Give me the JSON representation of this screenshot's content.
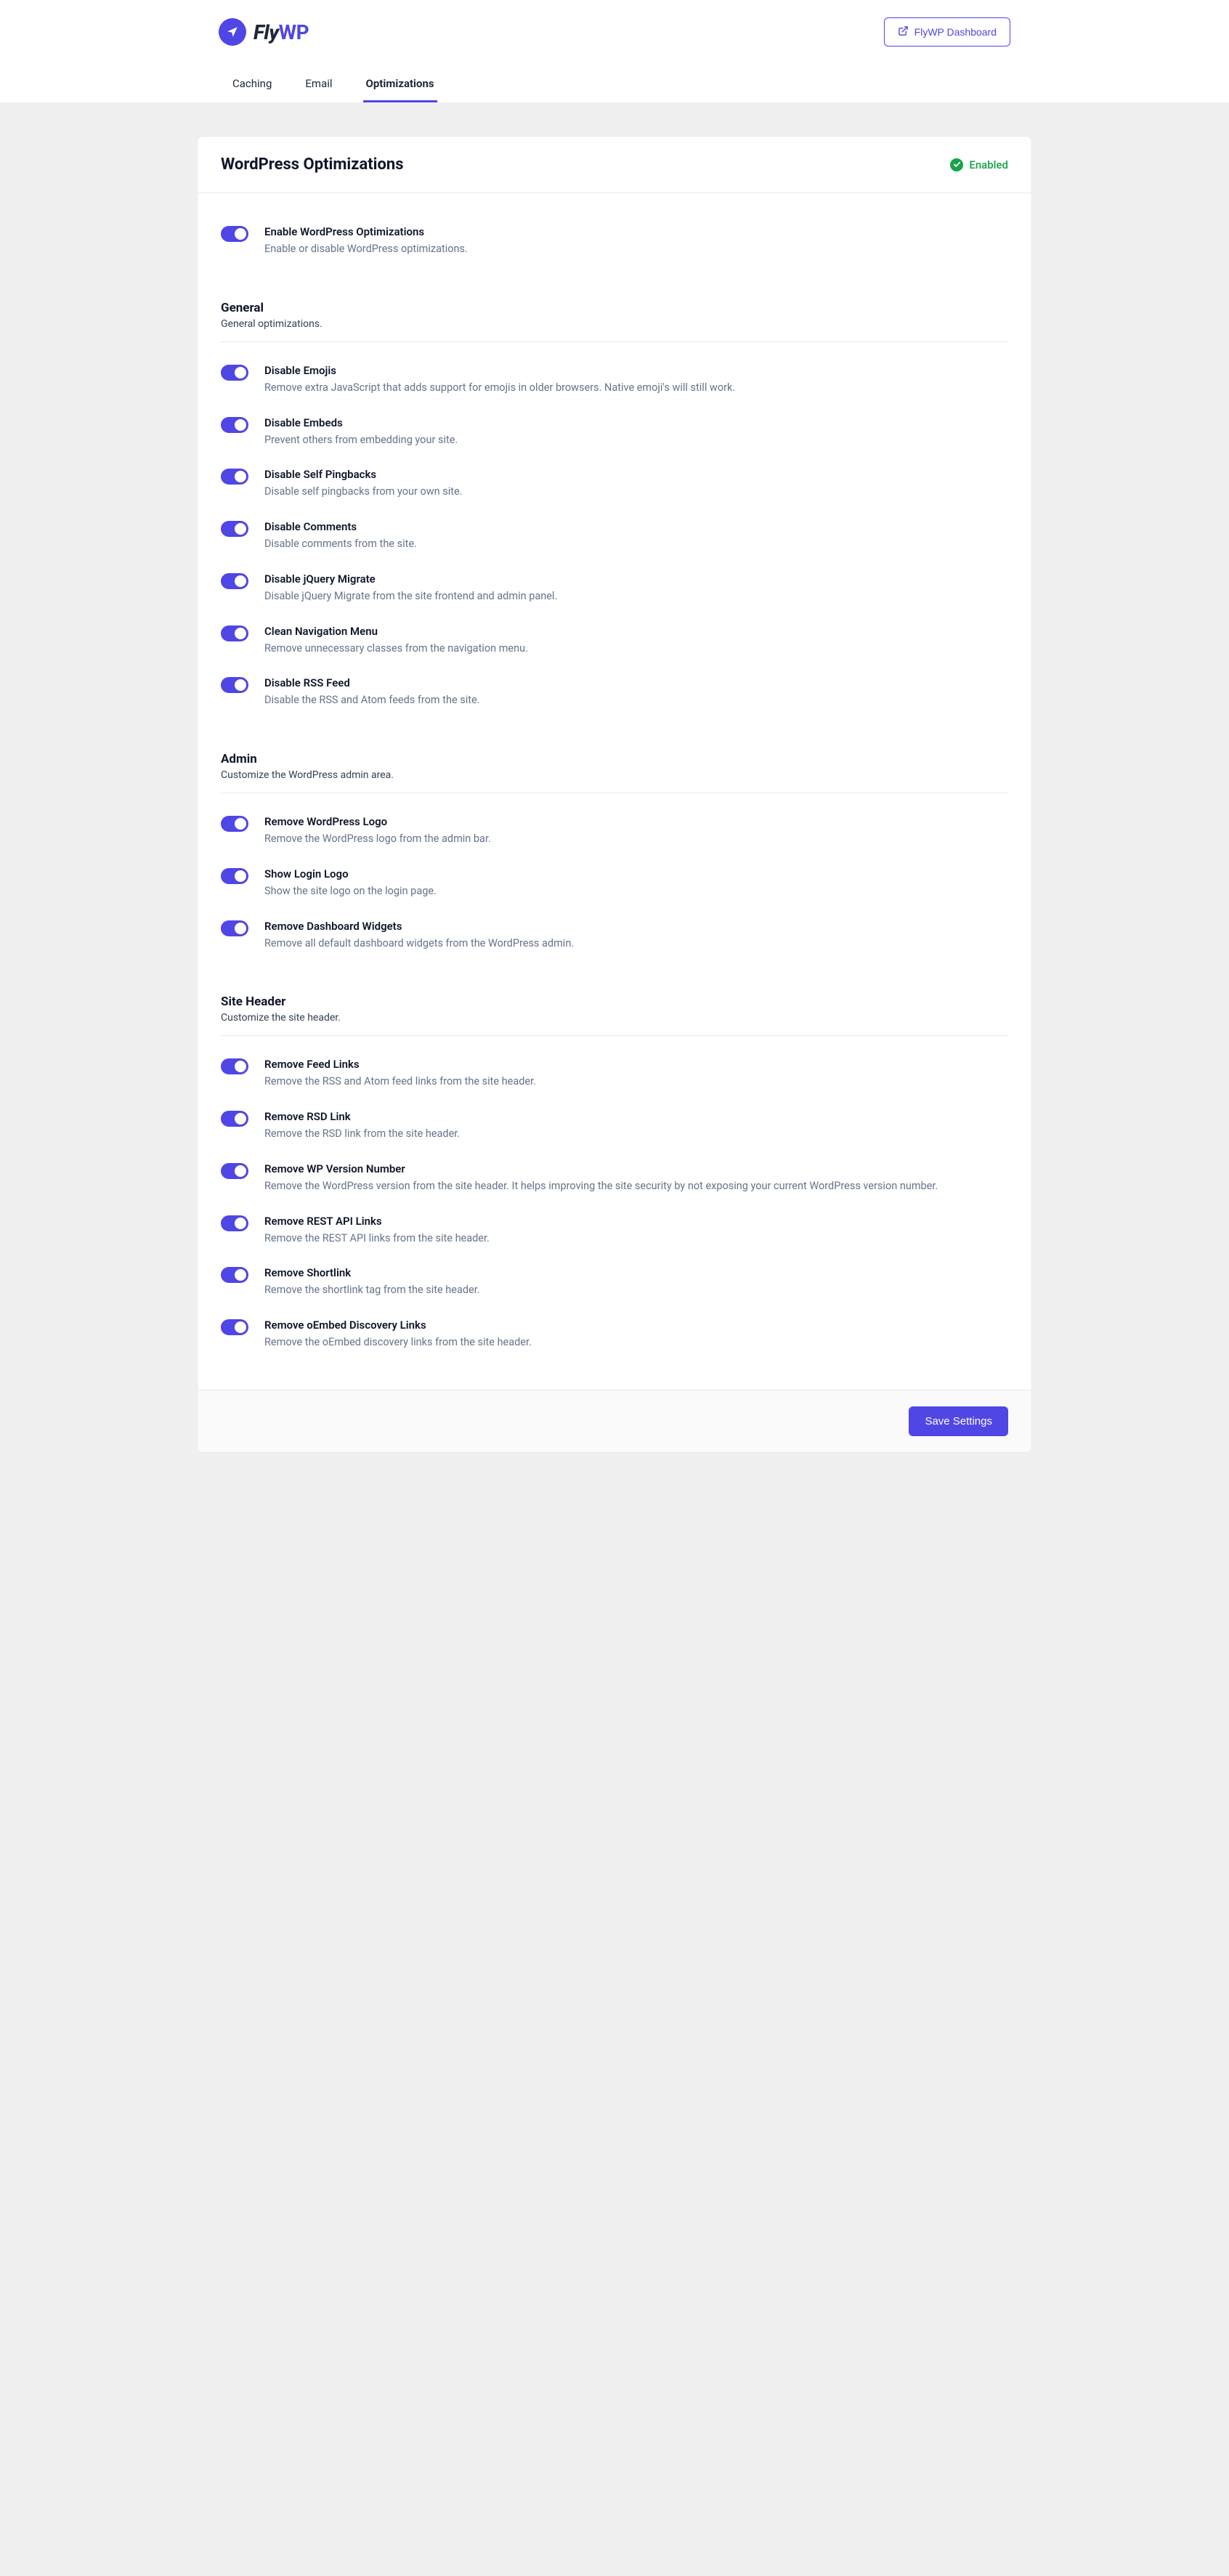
{
  "brand": {
    "name_prefix": "Fly",
    "name_suffix": "WP"
  },
  "dashboard_button": "FlyWP Dashboard",
  "tabs": [
    {
      "label": "Caching",
      "active": false
    },
    {
      "label": "Email",
      "active": false
    },
    {
      "label": "Optimizations",
      "active": true
    }
  ],
  "card": {
    "title": "WordPress Optimizations",
    "status": "Enabled"
  },
  "master": {
    "title": "Enable WordPress Optimizations",
    "desc": "Enable or disable WordPress optimizations."
  },
  "save_button": "Save Settings",
  "sections": [
    {
      "title": "General",
      "desc": "General optimizations.",
      "items": [
        {
          "title": "Disable Emojis",
          "desc": "Remove extra JavaScript that adds support for emojis in older browsers. Native emoji's will still work."
        },
        {
          "title": "Disable Embeds",
          "desc": "Prevent others from embedding your site."
        },
        {
          "title": "Disable Self Pingbacks",
          "desc": "Disable self pingbacks from your own site."
        },
        {
          "title": "Disable Comments",
          "desc": "Disable comments from the site."
        },
        {
          "title": "Disable jQuery Migrate",
          "desc": "Disable jQuery Migrate from the site frontend and admin panel."
        },
        {
          "title": "Clean Navigation Menu",
          "desc": "Remove unnecessary classes from the navigation menu."
        },
        {
          "title": "Disable RSS Feed",
          "desc": "Disable the RSS and Atom feeds from the site."
        }
      ]
    },
    {
      "title": "Admin",
      "desc": "Customize the WordPress admin area.",
      "items": [
        {
          "title": "Remove WordPress Logo",
          "desc": "Remove the WordPress logo from the admin bar."
        },
        {
          "title": "Show Login Logo",
          "desc": "Show the site logo on the login page."
        },
        {
          "title": "Remove Dashboard Widgets",
          "desc": "Remove all default dashboard widgets from the WordPress admin."
        }
      ]
    },
    {
      "title": "Site Header",
      "desc": "Customize the site header.",
      "items": [
        {
          "title": "Remove Feed Links",
          "desc": "Remove the RSS and Atom feed links from the site header."
        },
        {
          "title": "Remove RSD Link",
          "desc": "Remove the RSD link from the site header."
        },
        {
          "title": "Remove WP Version Number",
          "desc": "Remove the WordPress version from the site header. It helps improving the site security by not exposing your current WordPress version number."
        },
        {
          "title": "Remove REST API Links",
          "desc": "Remove the REST API links from the site header."
        },
        {
          "title": "Remove Shortlink",
          "desc": "Remove the shortlink tag from the site header."
        },
        {
          "title": "Remove oEmbed Discovery Links",
          "desc": "Remove the oEmbed discovery links from the site header."
        }
      ]
    }
  ]
}
